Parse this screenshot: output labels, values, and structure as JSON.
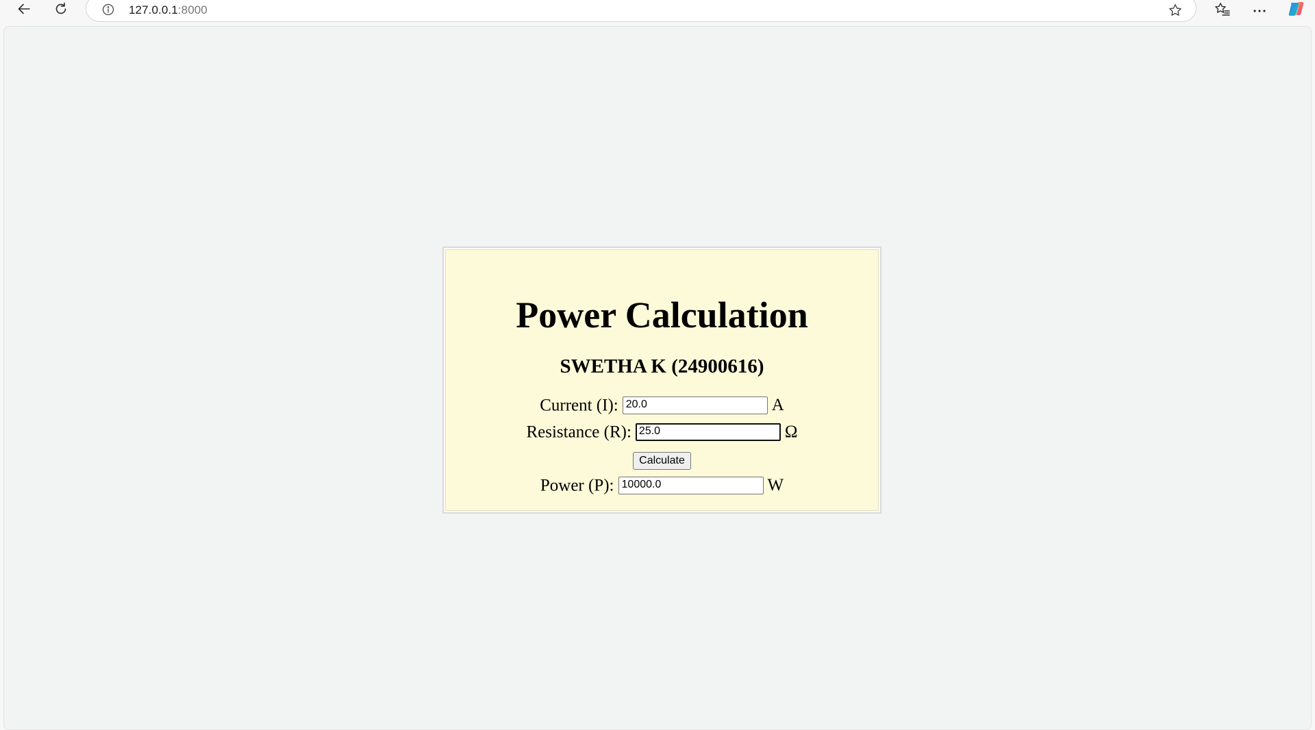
{
  "browser": {
    "url_host": "127.0.0.1",
    "url_port": ":8000",
    "icons": {
      "back": "back-arrow-icon",
      "reload": "reload-icon",
      "info": "info-icon",
      "favorite": "star-icon",
      "favorites": "favorites-icon",
      "menu": "more-icon",
      "copilot": "copilot-icon"
    }
  },
  "page": {
    "title": "Power Calculation",
    "subtitle": "SWETHA K (24900616)",
    "current": {
      "label": "Current (I):",
      "value": "20.0",
      "unit": "A"
    },
    "resistance": {
      "label": "Resistance (R):",
      "value": "25.0",
      "unit": "Ω"
    },
    "calculate_label": "Calculate",
    "power": {
      "label": "Power (P):",
      "value": "10000.0",
      "unit": "W"
    },
    "colors": {
      "card_background": "#fdfad9",
      "page_background": "#f2f3f3"
    }
  }
}
